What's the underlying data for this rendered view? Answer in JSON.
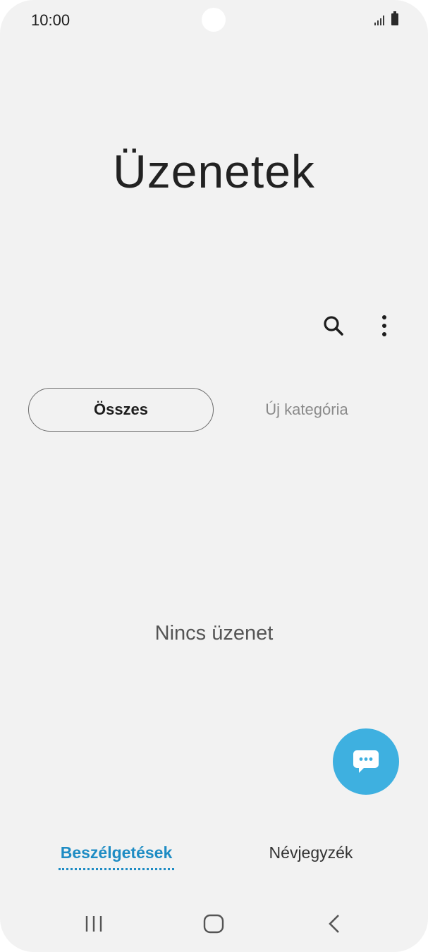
{
  "status_bar": {
    "time": "10:00",
    "signal_icon": "signal-icon",
    "battery_icon": "battery-icon"
  },
  "header": {
    "title": "Üzenetek"
  },
  "actions": {
    "search_icon": "search-icon",
    "more_icon": "more-vertical-icon"
  },
  "categories": {
    "all_label": "Összes",
    "new_label": "Új kategória"
  },
  "empty_state": {
    "text": "Nincs üzenet"
  },
  "fab": {
    "icon": "chat-bubble-icon",
    "color": "#3eb0e0"
  },
  "bottom_tabs": {
    "conversations_label": "Beszélgetések",
    "contacts_label": "Névjegyzék",
    "active_color": "#1e8cc4"
  },
  "nav_bar": {
    "recents_icon": "recents-icon",
    "home_icon": "home-icon",
    "back_icon": "back-icon"
  }
}
